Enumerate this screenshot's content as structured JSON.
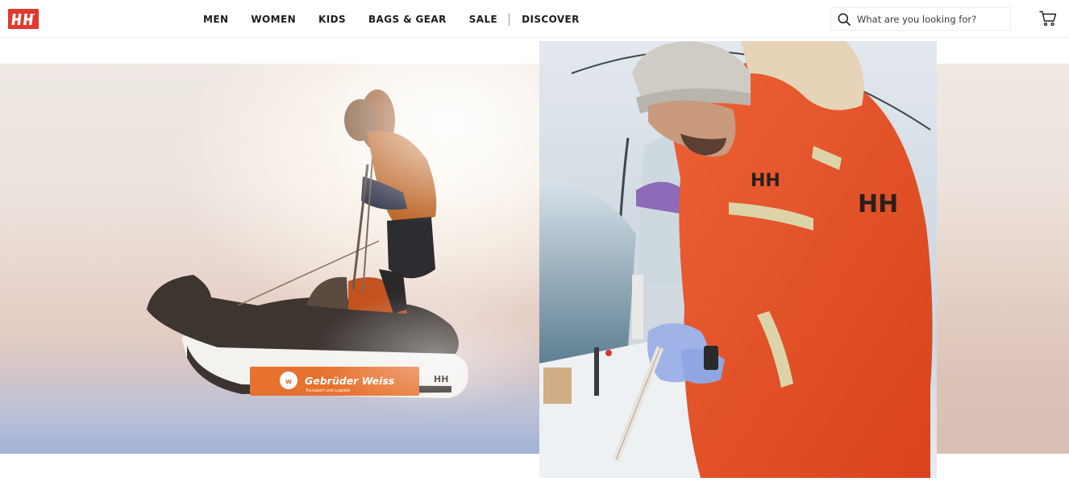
{
  "brand": {
    "logo_text": "HH",
    "color": "#e03a2f"
  },
  "nav": {
    "items": [
      {
        "label": "MEN"
      },
      {
        "label": "WOMEN"
      },
      {
        "label": "KIDS"
      },
      {
        "label": "BAGS & GEAR"
      },
      {
        "label": "SALE"
      }
    ],
    "discover_label": "DISCOVER"
  },
  "search": {
    "placeholder": "What are you looking for?",
    "icon": "search-icon"
  },
  "cart": {
    "icon": "cart-icon"
  },
  "hero": {
    "sled_brand": "Gebrüder Weiss",
    "sled_tagline": "Transport und Logistik",
    "sled_mark": "HH",
    "jacket_logo": "HH",
    "chest_logo": "HH",
    "accent_orange": "#e8552a"
  }
}
